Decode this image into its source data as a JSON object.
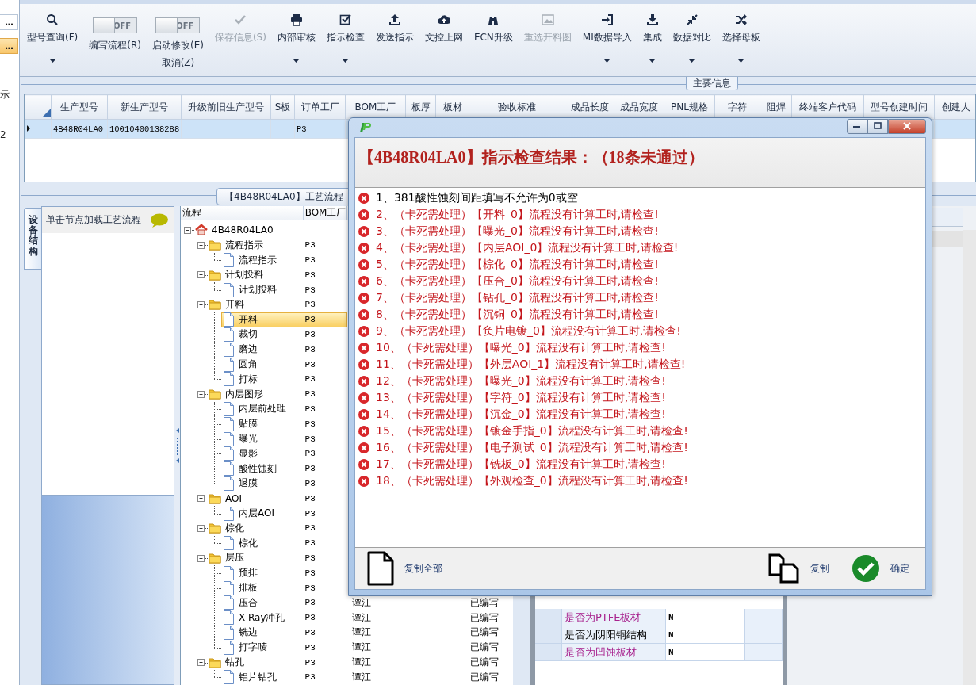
{
  "left_strip": {
    "buttons": [
      {
        "label": "...",
        "selected": false
      },
      {
        "label": "...",
        "selected": true
      }
    ],
    "texts": [
      "示",
      "2"
    ]
  },
  "toolbar": {
    "items": [
      {
        "kind": "button",
        "label": "型号查询(F)",
        "dropdown": true,
        "disabled": false
      },
      {
        "kind": "toggle",
        "switch_text": "OFF",
        "on": false,
        "label": "编写流程(R)"
      },
      {
        "kind": "toggle",
        "switch_text": "OFF",
        "on": false,
        "label": "启动修改(E)",
        "sublabel": "取消(Z)"
      },
      {
        "kind": "button",
        "label": "保存信息(S)",
        "dropdown": false,
        "disabled": true
      },
      {
        "kind": "button",
        "label": "内部审核",
        "dropdown": true,
        "disabled": false
      },
      {
        "kind": "button",
        "label": "指示检查",
        "dropdown": true,
        "disabled": false
      },
      {
        "kind": "button",
        "label": "发送指示",
        "dropdown": false,
        "disabled": false
      },
      {
        "kind": "button",
        "label": "文控上网",
        "dropdown": false,
        "disabled": false
      },
      {
        "kind": "button",
        "label": "ECN升级",
        "dropdown": false,
        "disabled": false
      },
      {
        "kind": "button",
        "label": "重选开料图",
        "dropdown": false,
        "disabled": true
      },
      {
        "kind": "button",
        "label": "MI数据导入",
        "dropdown": true,
        "disabled": false
      },
      {
        "kind": "button",
        "label": "集成",
        "dropdown": true,
        "disabled": false
      },
      {
        "kind": "button",
        "label": "数据对比",
        "dropdown": true,
        "disabled": false
      },
      {
        "kind": "button",
        "label": "选择母板",
        "dropdown": true,
        "disabled": false
      }
    ]
  },
  "main_info": {
    "title": "主要信息",
    "columns": [
      "生产型号",
      "新生产型号",
      "升级前旧生产型号",
      "S板",
      "订单工厂",
      "BOM工厂",
      "板厚",
      "板材",
      "验收标准",
      "成品长度",
      "成品宽度",
      "PNL规格",
      "字符",
      "阻焊",
      "终端客户代码",
      "型号创建时间",
      "创建人"
    ],
    "rows": [
      {
        "selected": true,
        "model": "4B48R04LA0",
        "new_model": "10010400138288",
        "order_factory": "P3"
      }
    ]
  },
  "process": {
    "title": "【4B48R04LA0】工艺流程",
    "side_tab": {
      "label": "设备结构",
      "selected": true
    },
    "hint": "单击节点加载工艺流程",
    "tree": {
      "columns": [
        "流程",
        "BOM工厂"
      ],
      "nodes": [
        {
          "kind": "root",
          "label": "4B48R04LA0",
          "expanded": true,
          "selected": false,
          "children": [
            {
              "kind": "folder",
              "label": "流程指示",
              "bom": "P3",
              "expanded": true,
              "selected": false,
              "children": [
                {
                  "kind": "file",
                  "label": "流程指示",
                  "bom": "P3",
                  "selected": false
                }
              ]
            },
            {
              "kind": "folder",
              "label": "计划投料",
              "bom": "P3",
              "expanded": true,
              "selected": false,
              "children": [
                {
                  "kind": "file",
                  "label": "计划投料",
                  "bom": "P3",
                  "selected": false
                }
              ]
            },
            {
              "kind": "folder",
              "label": "开料",
              "bom": "P3",
              "expanded": true,
              "selected": false,
              "children": [
                {
                  "kind": "file",
                  "label": "开料",
                  "bom": "P3",
                  "selected": true
                },
                {
                  "kind": "file",
                  "label": "裁切",
                  "bom": "P3",
                  "selected": false
                },
                {
                  "kind": "file",
                  "label": "磨边",
                  "bom": "P3",
                  "selected": false
                },
                {
                  "kind": "file",
                  "label": "圆角",
                  "bom": "P3",
                  "selected": false
                },
                {
                  "kind": "file",
                  "label": "打标",
                  "bom": "P3",
                  "selected": false
                }
              ]
            },
            {
              "kind": "folder",
              "label": "内层图形",
              "bom": "P3",
              "expanded": true,
              "selected": false,
              "children": [
                {
                  "kind": "file",
                  "label": "内层前处理",
                  "bom": "P3",
                  "selected": false
                },
                {
                  "kind": "file",
                  "label": "贴膜",
                  "bom": "P3",
                  "selected": false
                },
                {
                  "kind": "file",
                  "label": "曝光",
                  "bom": "P3",
                  "selected": false
                },
                {
                  "kind": "file",
                  "label": "显影",
                  "bom": "P3",
                  "selected": false
                },
                {
                  "kind": "file",
                  "label": "酸性蚀刻",
                  "bom": "P3",
                  "selected": false
                },
                {
                  "kind": "file",
                  "label": "退膜",
                  "bom": "P3",
                  "selected": false
                }
              ]
            },
            {
              "kind": "folder",
              "label": "AOI",
              "bom": "P3",
              "expanded": true,
              "selected": false,
              "children": [
                {
                  "kind": "file",
                  "label": "内层AOI",
                  "bom": "P3",
                  "selected": false
                }
              ]
            },
            {
              "kind": "folder",
              "label": "棕化",
              "bom": "P3",
              "expanded": true,
              "selected": false,
              "children": [
                {
                  "kind": "file",
                  "label": "棕化",
                  "bom": "P3",
                  "selected": false
                }
              ]
            },
            {
              "kind": "folder",
              "label": "层压",
              "bom": "P3",
              "expanded": true,
              "selected": false,
              "children": [
                {
                  "kind": "file",
                  "label": "预排",
                  "bom": "P3",
                  "selected": false
                },
                {
                  "kind": "file",
                  "label": "排板",
                  "bom": "P3",
                  "selected": false
                },
                {
                  "kind": "file",
                  "label": "压合",
                  "bom": "P3",
                  "col_3": "谭江",
                  "col_5": "已编写",
                  "selected": false
                },
                {
                  "kind": "file",
                  "label": "X-Ray冲孔",
                  "bom": "P3",
                  "col_3": "谭江",
                  "col_5": "已编写",
                  "selected": false
                },
                {
                  "kind": "file",
                  "label": "铣边",
                  "bom": "P3",
                  "col_3": "谭江",
                  "col_5": "已编写",
                  "selected": false
                },
                {
                  "kind": "file",
                  "label": "打字唛",
                  "bom": "P3",
                  "col_3": "谭江",
                  "col_5": "已编写",
                  "selected": false
                }
              ]
            },
            {
              "kind": "folder",
              "label": "钻孔",
              "bom": "P3",
              "col_3": "谭江",
              "col_5": "已编写",
              "expanded": true,
              "selected": false,
              "children": [
                {
                  "kind": "file",
                  "label": "铝片钻孔",
                  "bom": "P3",
                  "col_3": "谭江",
                  "col_5": "已编写",
                  "selected": false
                }
              ]
            }
          ]
        }
      ]
    }
  },
  "properties": {
    "rows": [
      {
        "label": "是否为PTFE板材",
        "value": "N",
        "color": "#a8238e"
      },
      {
        "label": "是否为阴阳铜结构",
        "value": "N",
        "color": "#000000"
      },
      {
        "label": "是否为凹蚀板材",
        "value": "N",
        "color": "#a8238e"
      }
    ]
  },
  "dialog": {
    "header": "【4B48R04LA0】指示检查结果：（18条未通过）",
    "items": [
      {
        "text": "1、381酸性蚀刻间距填写不允许为0或空",
        "color": "#000000"
      },
      {
        "text": "2、（卡死需处理）【开料_0】流程没有计算工时,请检查!",
        "color": "#c4161c"
      },
      {
        "text": "3、（卡死需处理）【曝光_0】流程没有计算工时,请检查!",
        "color": "#c4161c"
      },
      {
        "text": "4、（卡死需处理）【内层AOI_0】流程没有计算工时,请检查!",
        "color": "#c4161c"
      },
      {
        "text": "5、（卡死需处理）【棕化_0】流程没有计算工时,请检查!",
        "color": "#c4161c"
      },
      {
        "text": "6、（卡死需处理）【压合_0】流程没有计算工时,请检查!",
        "color": "#c4161c"
      },
      {
        "text": "7、（卡死需处理）【钻孔_0】流程没有计算工时,请检查!",
        "color": "#c4161c"
      },
      {
        "text": "8、（卡死需处理）【沉铜_0】流程没有计算工时,请检查!",
        "color": "#c4161c"
      },
      {
        "text": "9、（卡死需处理）【负片电镀_0】流程没有计算工时,请检查!",
        "color": "#c4161c"
      },
      {
        "text": "10、（卡死需处理）【曝光_0】流程没有计算工时,请检查!",
        "color": "#c4161c"
      },
      {
        "text": "11、（卡死需处理）【外层AOI_1】流程没有计算工时,请检查!",
        "color": "#c4161c"
      },
      {
        "text": "12、（卡死需处理）【曝光_0】流程没有计算工时,请检查!",
        "color": "#c4161c"
      },
      {
        "text": "13、（卡死需处理）【字符_0】流程没有计算工时,请检查!",
        "color": "#c4161c"
      },
      {
        "text": "14、（卡死需处理）【沉金_0】流程没有计算工时,请检查!",
        "color": "#c4161c"
      },
      {
        "text": "15、（卡死需处理）【镀金手指_0】流程没有计算工时,请检查!",
        "color": "#c4161c"
      },
      {
        "text": "16、（卡死需处理）【电子测试_0】流程没有计算工时,请检查!",
        "color": "#c4161c"
      },
      {
        "text": "17、（卡死需处理）【铣板_0】流程没有计算工时,请检查!",
        "color": "#c4161c"
      },
      {
        "text": "18、（卡死需处理）【外观检查_0】流程没有计算工时,请检查!",
        "color": "#c4161c"
      }
    ],
    "buttons": [
      {
        "label": "复制全部"
      },
      {
        "label": "复制"
      },
      {
        "label": "确定"
      }
    ]
  }
}
